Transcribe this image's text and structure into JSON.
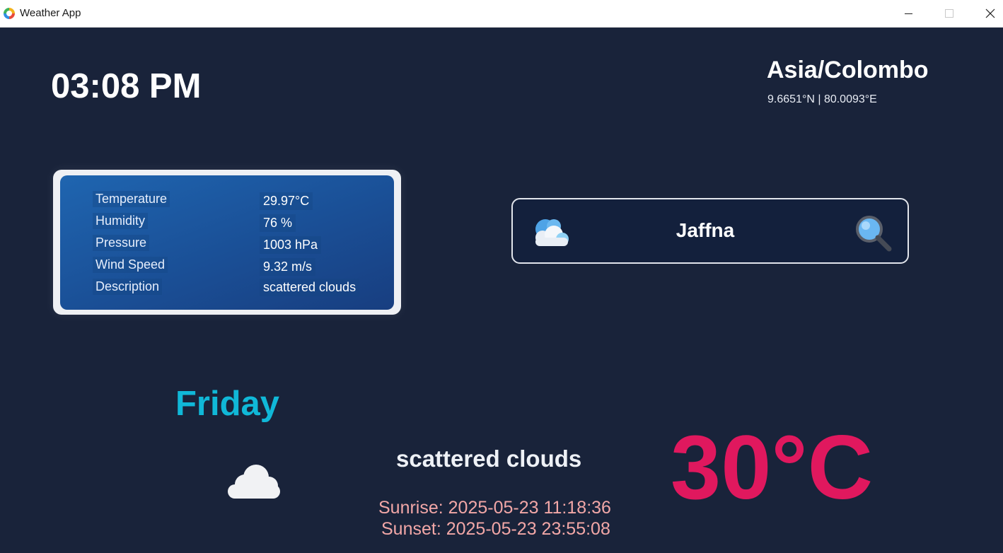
{
  "window": {
    "title": "Weather App",
    "controls": {
      "minimize": "—",
      "maximize": "☐",
      "close": "✕"
    }
  },
  "header": {
    "time": "03:08 PM",
    "timezone": "Asia/Colombo",
    "coordinates": "9.6651°N  |  80.0093°E"
  },
  "details": [
    {
      "label": "Temperature",
      "value": "29.97°C"
    },
    {
      "label": "Humidity",
      "value": "76 %"
    },
    {
      "label": "Pressure",
      "value": "1003 hPa"
    },
    {
      "label": "Wind Speed",
      "value": "9.32 m/s"
    },
    {
      "label": "Description",
      "value": "scattered clouds"
    }
  ],
  "search": {
    "value": "Jaffna",
    "left_icon": "cloud-icon",
    "right_icon": "search-icon"
  },
  "forecast": {
    "day": "Friday",
    "condition": "scattered clouds",
    "condition_icon": "cloud-icon",
    "sunrise": "Sunrise: 2025-05-23 11:18:36",
    "sunset": "Sunset: 2025-05-23 23:55:08",
    "temperature": "30°C"
  },
  "colors": {
    "background": "#19233a",
    "day_accent": "#10b8d8",
    "temperature_accent": "#e0185e",
    "sun_times": "#f2a7a7",
    "card_blue": "#1a4f96"
  }
}
